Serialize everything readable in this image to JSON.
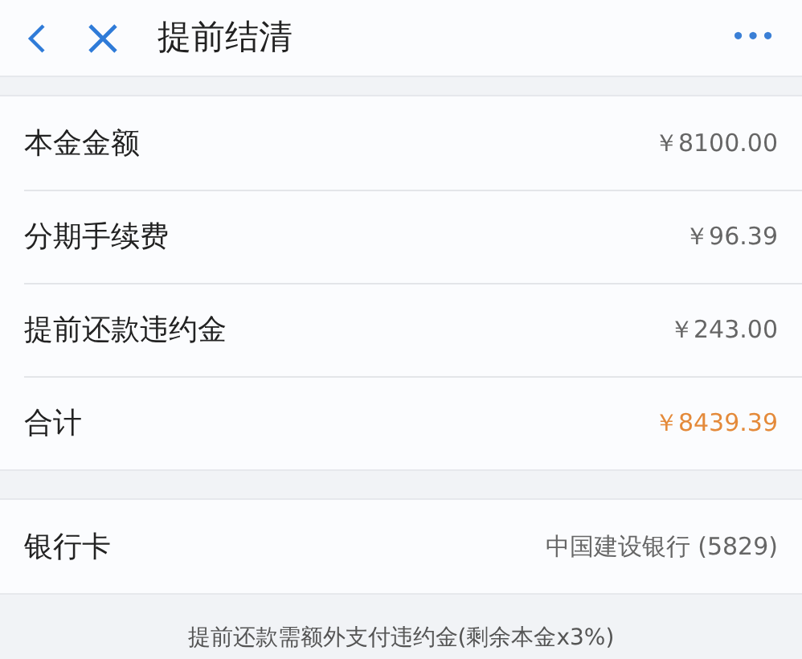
{
  "header": {
    "title": "提前结清",
    "more": "•••"
  },
  "summary": [
    {
      "label": "本金金额",
      "value": "￥8100.00",
      "kind": "amount"
    },
    {
      "label": "分期手续费",
      "value": "￥96.39",
      "kind": "amount"
    },
    {
      "label": "提前还款违约金",
      "value": "￥243.00",
      "kind": "amount"
    },
    {
      "label": "合计",
      "value": "￥8439.39",
      "kind": "total"
    }
  ],
  "bank": {
    "label": "银行卡",
    "value": "中国建设银行 (5829)"
  },
  "note": "提前还款需额外支付违约金(剩余本金x3%)"
}
